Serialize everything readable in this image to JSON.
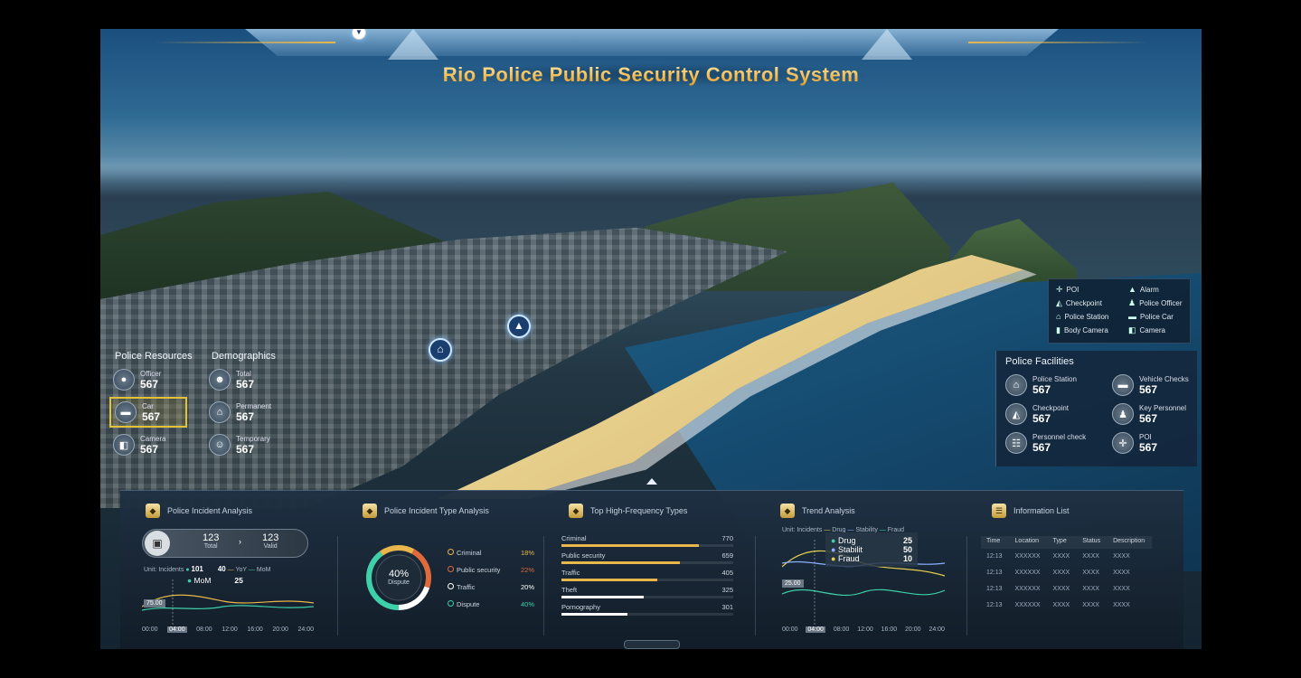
{
  "header": {
    "title": "Rio Police Public Security Control System"
  },
  "left_overlay": {
    "resources_title": "Police Resources",
    "demographics_title": "Demographics",
    "resources": [
      {
        "label": "Officer",
        "value": "567",
        "icon": "officer-icon"
      },
      {
        "label": "Car",
        "value": "567",
        "icon": "car-icon"
      },
      {
        "label": "Camera",
        "value": "567",
        "icon": "camera-icon"
      }
    ],
    "demographics": [
      {
        "label": "Total",
        "value": "567",
        "icon": "people-icon"
      },
      {
        "label": "Permanent",
        "value": "567",
        "icon": "house-icon"
      },
      {
        "label": "Temporary",
        "value": "567",
        "icon": "group-icon"
      }
    ]
  },
  "legend": [
    {
      "label": "POI",
      "icon": "crosshair-icon"
    },
    {
      "label": "Alarm",
      "icon": "alarm-icon"
    },
    {
      "label": "Checkpoint",
      "icon": "checkpoint-icon"
    },
    {
      "label": "Police Officer",
      "icon": "officer-icon"
    },
    {
      "label": "Police Station",
      "icon": "station-icon"
    },
    {
      "label": "Police Car",
      "icon": "car-icon"
    },
    {
      "label": "Body Camera",
      "icon": "bodycam-icon"
    },
    {
      "label": "Camera",
      "icon": "camera-icon"
    }
  ],
  "facilities": {
    "title": "Police Facilities",
    "items": [
      {
        "label": "Police Station",
        "value": "567",
        "icon": "station-icon"
      },
      {
        "label": "Vehicle Checks",
        "value": "567",
        "icon": "vehicle-icon"
      },
      {
        "label": "Checkpoint",
        "value": "567",
        "icon": "checkpoint-icon"
      },
      {
        "label": "Key Personnel",
        "value": "567",
        "icon": "person-icon"
      },
      {
        "label": "Personnel check",
        "value": "567",
        "icon": "id-check-icon"
      },
      {
        "label": "POI",
        "value": "567",
        "icon": "crosshair-icon"
      }
    ]
  },
  "panels": {
    "incident_analysis": {
      "title": "Police Incident Analysis",
      "total_value": "123",
      "total_label": "Total",
      "valid_value": "123",
      "valid_label": "Valid",
      "legend_prefix": "Unit: Incidents",
      "yoy_value": "101",
      "mom_value": "40",
      "yoy_label": "YoY",
      "mom_legend_label": "MoM",
      "tooltip_label": "MoM",
      "tooltip_value": "25",
      "y_label": "75.00",
      "times": [
        "00:00",
        "04:00",
        "08:00",
        "12:00",
        "16:00",
        "20:00",
        "24:00"
      ]
    },
    "type_analysis": {
      "title": "Police Incident Type Analysis",
      "center_value": "40%",
      "center_label": "Dispute",
      "items": [
        {
          "label": "Criminal",
          "value": "18%",
          "color": "#e8b64a"
        },
        {
          "label": "Public security",
          "value": "22%",
          "color": "#e06a3a"
        },
        {
          "label": "Traffic",
          "value": "20%",
          "color": "#ffffff"
        },
        {
          "label": "Dispute",
          "value": "40%",
          "color": "#3ed0a8"
        }
      ]
    },
    "high_frequency": {
      "title": "Top High-Frequency Types",
      "items": [
        {
          "label": "Criminal",
          "value": "770",
          "pct": 1.0,
          "color": "#e8b64a"
        },
        {
          "label": "Public security",
          "value": "659",
          "pct": 0.86,
          "color": "#e8b64a"
        },
        {
          "label": "Traffic",
          "value": "405",
          "pct": 0.7,
          "color": "#e8b64a"
        },
        {
          "label": "Theft",
          "value": "325",
          "pct": 0.6,
          "color": "#ffffff"
        },
        {
          "label": "Pornography",
          "value": "301",
          "pct": 0.48,
          "color": "#ffffff"
        }
      ]
    },
    "trend": {
      "title": "Trend Analysis",
      "unit": "Unit: Incidents",
      "legend": [
        "Drug",
        "Stability",
        "Fraud"
      ],
      "tooltip": [
        {
          "label": "Drug",
          "value": "25",
          "color": "#3ed0a8"
        },
        {
          "label": "Stabilit",
          "value": "50",
          "color": "#8fb0ff"
        },
        {
          "label": "Fraud",
          "value": "10",
          "color": "#e8d24a"
        }
      ],
      "y_label": "25.00",
      "times": [
        "00:00",
        "04:00",
        "08:00",
        "12:00",
        "16:00",
        "20:00",
        "24:00"
      ]
    },
    "info_list": {
      "title": "Information List",
      "columns": [
        "Time",
        "Location",
        "Type",
        "Status",
        "Description"
      ],
      "rows": [
        [
          "12:13",
          "XXXXXX",
          "XXXX",
          "XXXX",
          "XXXX"
        ],
        [
          "12:13",
          "XXXXXX",
          "XXXX",
          "XXXX",
          "XXXX"
        ],
        [
          "12:13",
          "XXXXXX",
          "XXXX",
          "XXXX",
          "XXXX"
        ],
        [
          "12:13",
          "XXXXXX",
          "XXXX",
          "XXXX",
          "XXXX"
        ]
      ]
    }
  }
}
